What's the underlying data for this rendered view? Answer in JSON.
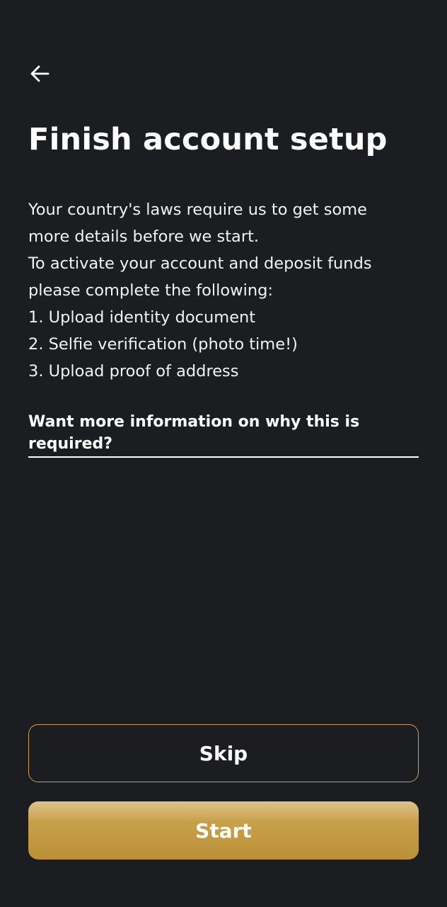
{
  "header": {
    "back_icon": "arrow-left-icon"
  },
  "title": "Finish account setup",
  "intro_lines": [
    "Your country's laws require us to get some",
    "more details before we start.",
    "To activate your account and deposit funds",
    "please complete the following:",
    "1. Upload identity document",
    "2. Selfie verification (photo time!)",
    "3. Upload proof of address"
  ],
  "more_info_link": "Want more information on why this is required?",
  "buttons": {
    "skip_label": "Skip",
    "start_label": "Start"
  },
  "colors": {
    "background": "#1c1d21",
    "accent_gold": "#c9a14a",
    "text": "#ffffff"
  }
}
